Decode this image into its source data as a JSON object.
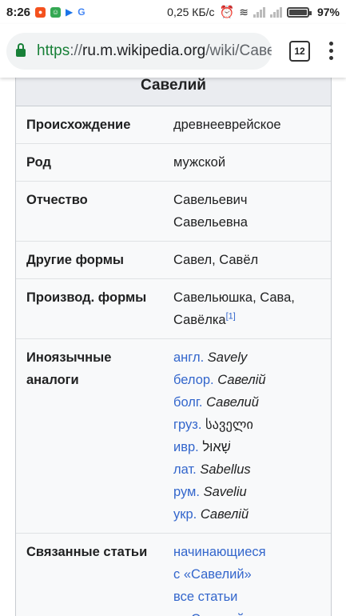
{
  "status_bar": {
    "time": "8:26",
    "net_speed": "0,25 КБ/с",
    "battery": "97%"
  },
  "browser": {
    "url_scheme": "https",
    "url_sep": "://",
    "url_host": "ru.m.wikipedia.org",
    "url_path": "/wiki/Савелий",
    "tab_count": "12"
  },
  "infobox": {
    "title": "Савелий",
    "rows": {
      "origin": {
        "label": "Происхождение",
        "value": "древнееврейское"
      },
      "gender": {
        "label": "Род",
        "value": "мужской"
      },
      "patronymic": {
        "label": "Отчество",
        "lines": [
          "Савельевич",
          "Савельевна"
        ]
      },
      "other_forms": {
        "label": "Другие формы",
        "value": "Савел, Савёл"
      },
      "derived_forms": {
        "label": "Производ. формы",
        "line1": "Савельюшка, Сава,",
        "line2": "Савёлка",
        "ref": "[1]"
      },
      "foreign": {
        "label_line1": "Иноязычные",
        "label_line2": "аналоги",
        "items": [
          {
            "lang": "англ.",
            "name": "Savely"
          },
          {
            "lang": "белор.",
            "name": "Савелій"
          },
          {
            "lang": "болг.",
            "name": "Савелий"
          },
          {
            "lang": "груз.",
            "name": "საველი"
          },
          {
            "lang": "ивр.",
            "name": "שָׁאוּל"
          },
          {
            "lang": "лат.",
            "name": "Sabellus"
          },
          {
            "lang": "рум.",
            "name": "Saveliu"
          },
          {
            "lang": "укр.",
            "name": "Савелій"
          }
        ]
      },
      "related": {
        "label": "Связанные статьи",
        "lines": [
          "начинающиеся",
          "с «Савелий»",
          "все статьи",
          "с «Савелий»"
        ]
      }
    }
  }
}
